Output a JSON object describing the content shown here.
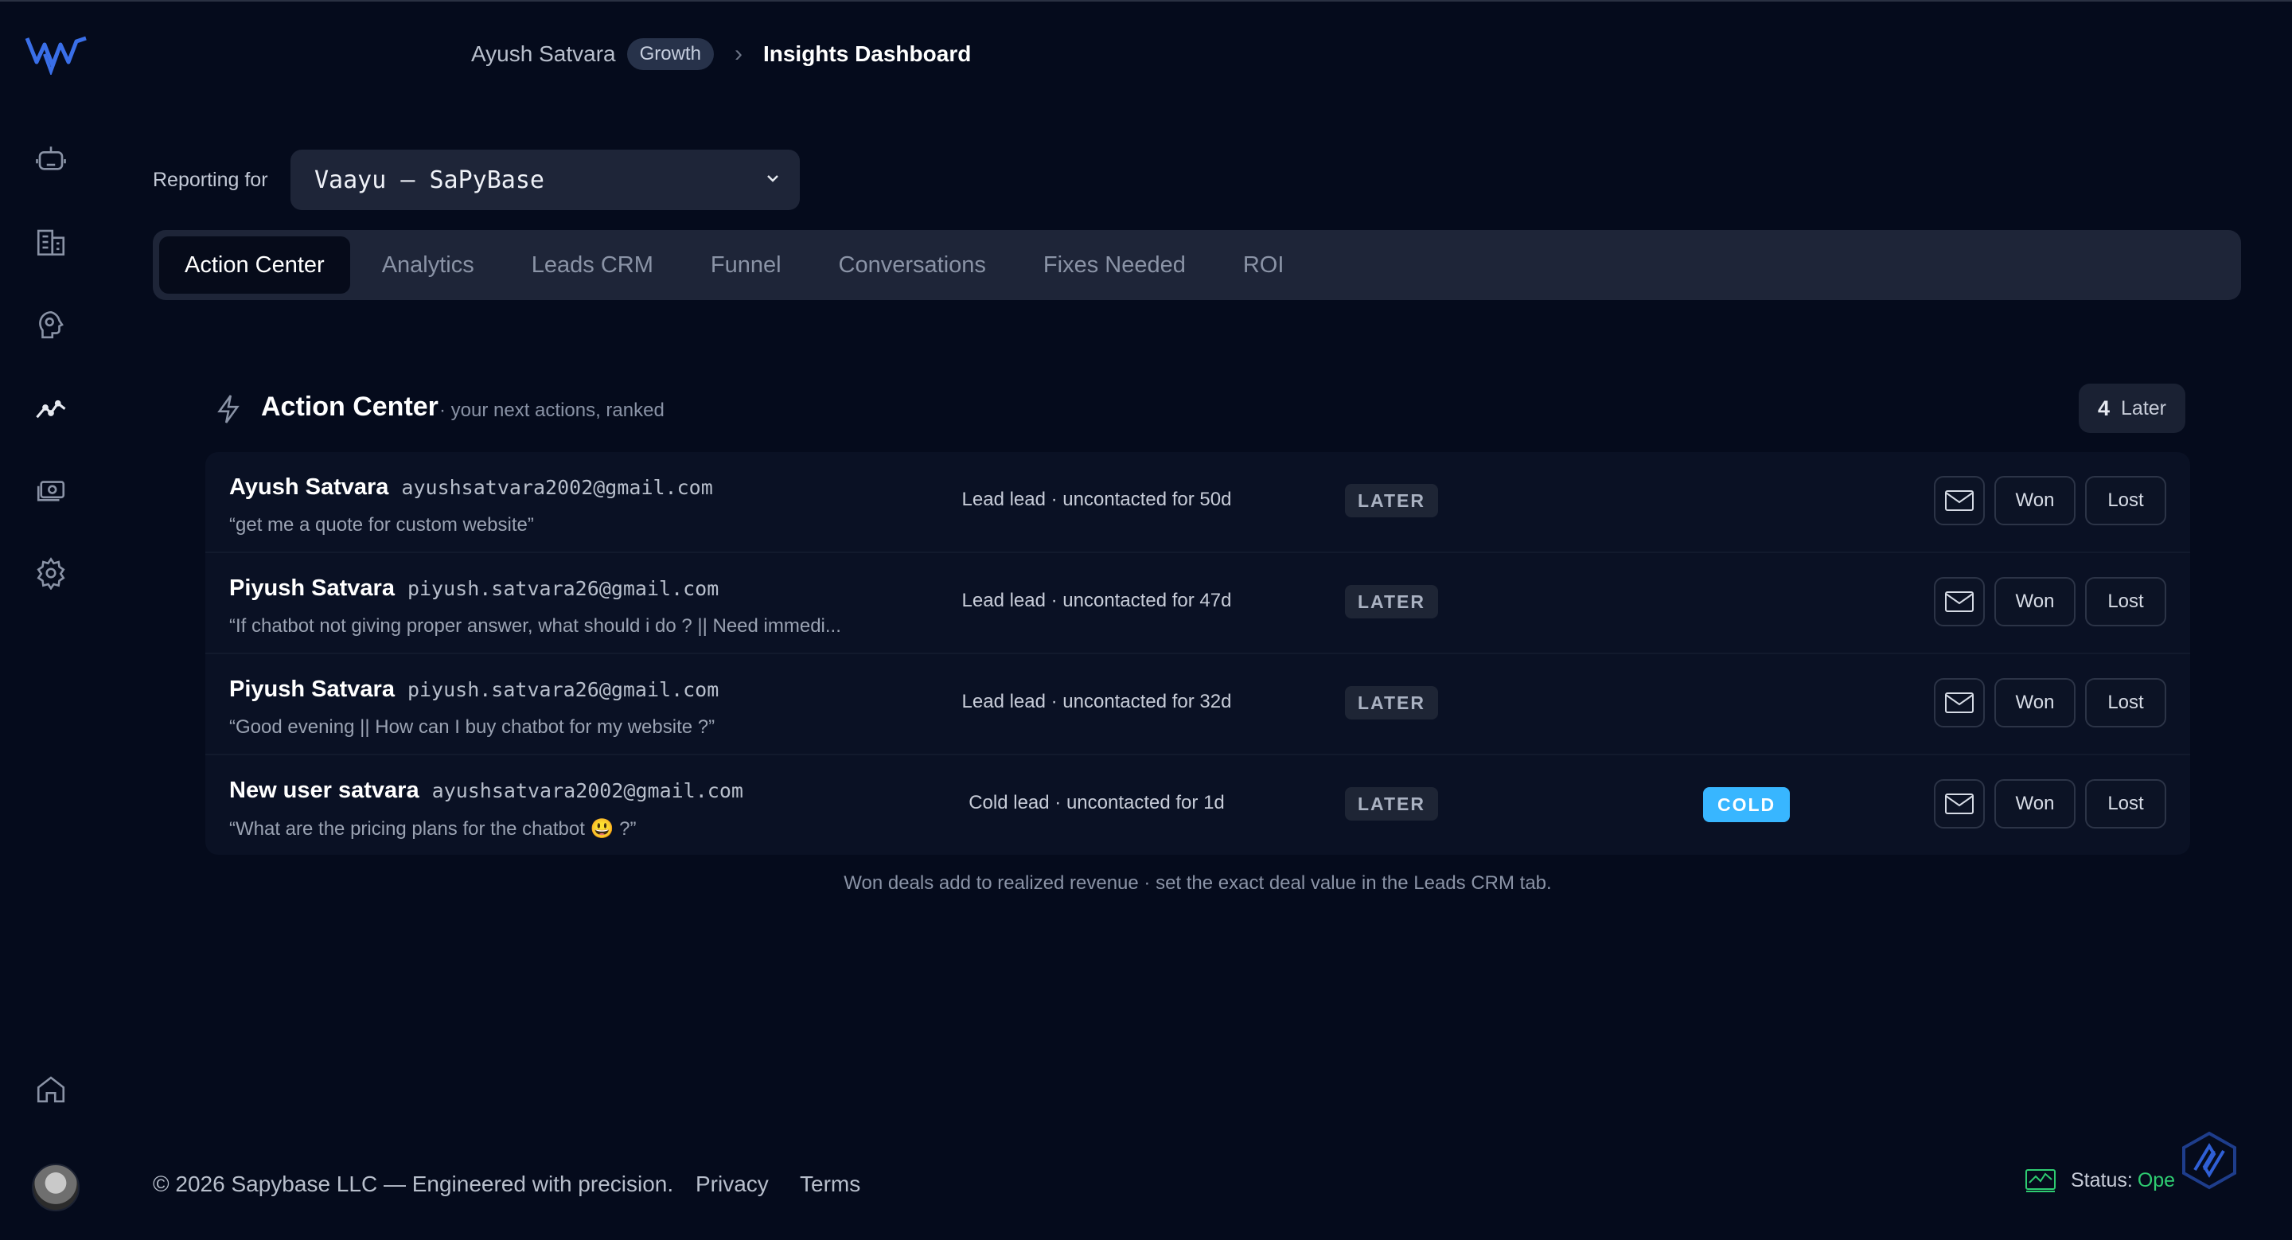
{
  "header": {
    "user": "Ayush Satvara",
    "plan_badge": "Growth",
    "current_page": "Insights Dashboard"
  },
  "reporting": {
    "label": "Reporting for",
    "selected": "Vaayu — SaPyBase"
  },
  "tabs": [
    {
      "label": "Action Center",
      "active": true
    },
    {
      "label": "Analytics"
    },
    {
      "label": "Leads CRM"
    },
    {
      "label": "Funnel"
    },
    {
      "label": "Conversations"
    },
    {
      "label": "Fixes Needed"
    },
    {
      "label": "ROI"
    }
  ],
  "action_center": {
    "title": "Action Center",
    "subtitle": "· your next actions, ranked",
    "later_count": "4",
    "later_label": "Later",
    "rows": [
      {
        "name": "Ayush Satvara",
        "email": "ayushsatvara2002@gmail.com",
        "quote": "“get me a quote for custom website”",
        "status": "Lead lead · uncontacted for 50d",
        "tag": "LATER",
        "temp": ""
      },
      {
        "name": "Piyush Satvara",
        "email": "piyush.satvara26@gmail.com",
        "quote": "“If chatbot not giving proper answer, what should i do ? || Need immedi...",
        "status": "Lead lead · uncontacted for 47d",
        "tag": "LATER",
        "temp": ""
      },
      {
        "name": "Piyush Satvara",
        "email": "piyush.satvara26@gmail.com",
        "quote": "“Good evening || How can I buy chatbot for my website ?”",
        "status": "Lead lead · uncontacted for 32d",
        "tag": "LATER",
        "temp": ""
      },
      {
        "name": "New user satvara",
        "email": "ayushsatvara2002@gmail.com",
        "quote": "“What are the pricing plans for the chatbot 😃 ?”",
        "status": "Cold lead · uncontacted for 1d",
        "tag": "LATER",
        "temp": "COLD"
      }
    ],
    "won_label": "Won",
    "lost_label": "Lost",
    "footnote": "Won deals add to realized revenue · set the exact deal value in the Leads CRM tab."
  },
  "footer": {
    "copyright": "© 2026 Sapybase LLC — Engineered with precision.",
    "privacy": "Privacy",
    "terms": "Terms",
    "status_label": "Status:",
    "status_value": "Ope"
  },
  "colors": {
    "background": "#050b1c",
    "accent_blue": "#38b6ff",
    "status_green": "#2ecc71"
  },
  "icons": [
    "logo",
    "bot-icon",
    "building-icon",
    "brain-icon",
    "trend-chart-icon",
    "money-icon",
    "settings-icon",
    "home-icon",
    "bolt-icon",
    "mail-icon",
    "chevron-down-icon",
    "status-monitor-icon",
    "help-fab-icon"
  ]
}
